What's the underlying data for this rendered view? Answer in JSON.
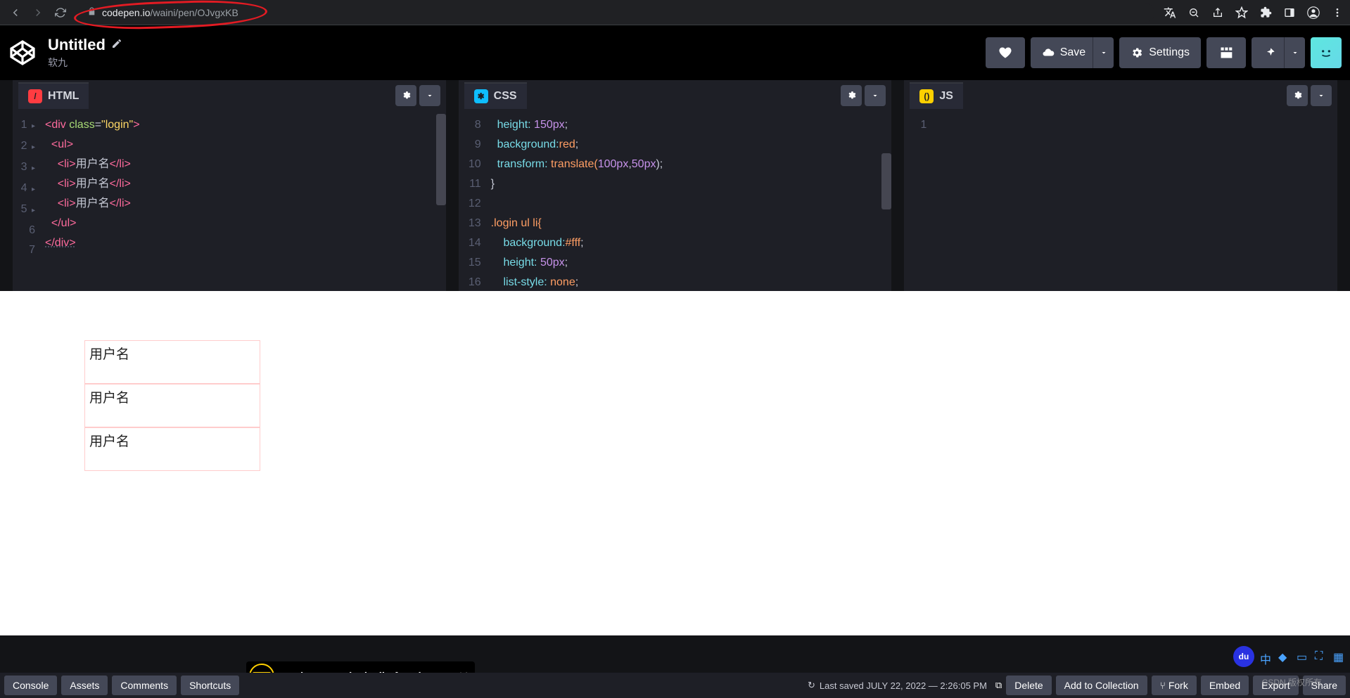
{
  "browser": {
    "url_host": "codepen.io",
    "url_path": "/waini/pen/OJvgxKB"
  },
  "header": {
    "title": "Untitled",
    "author": "软九",
    "save": "Save",
    "settings": "Settings"
  },
  "panes": {
    "html": {
      "label": "HTML"
    },
    "css": {
      "label": "CSS"
    },
    "js": {
      "label": "JS"
    }
  },
  "html_code": {
    "l1": "<div class=\"login\">",
    "l2": "  <ul>",
    "l3a": "    <li>",
    "l3b": "用户名",
    "l3c": "</li>",
    "l4a": "    <li>",
    "l4b": "用户名",
    "l4c": "</li>",
    "l5a": "    <li>",
    "l5b": "用户名",
    "l5c": "</li>",
    "l6": "  </ul>",
    "l7": "</div>"
  },
  "css_code": {
    "n8": "8",
    "n9": "9",
    "n10": "10",
    "n11": "11",
    "n12": "12",
    "n13": "13",
    "n14": "14",
    "n15": "15",
    "n16": "16",
    "l8a": "  height:",
    "l8b": " 150px",
    "l8c": ";",
    "l9a": "  background:",
    "l9b": "red",
    "l9c": ";",
    "l10a": "  transform:",
    "l10b": " translate(",
    "l10c": "100px",
    "l10d": ",",
    "l10e": "50px",
    "l10f": ");",
    "l11": "}",
    "l12": "",
    "l13": ".login ul li{",
    "l14a": "    background:",
    "l14b": "#fff",
    "l14c": ";",
    "l15a": "    height:",
    "l15b": " 50px",
    "l15c": ";",
    "l16a": "    list-style:",
    "l16b": " none",
    "l16c": ";"
  },
  "preview": {
    "item": "用户名"
  },
  "footer": {
    "console": "Console",
    "assets": "Assets",
    "comments": "Comments",
    "shortcuts": "Shortcuts",
    "save_status": "Last saved JULY 22, 2022 — 2:26:05 PM",
    "delete": "Delete",
    "add": "Add to Collection",
    "fork": "Fork",
    "embed": "Embed",
    "export": "Export",
    "share": "Share"
  },
  "banner": {
    "text": "CodePen: Unlock all of CodePen",
    "pro": "PRO"
  },
  "watermark": "CSDN 版权所有",
  "baidu": "du"
}
